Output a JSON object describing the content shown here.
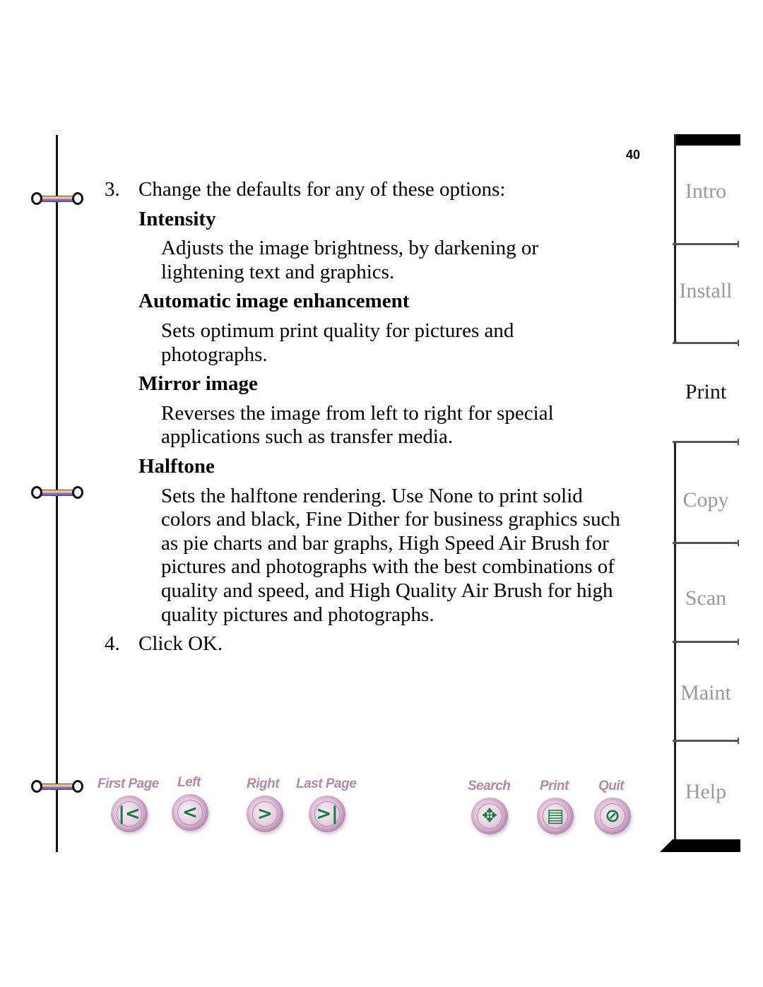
{
  "page_number": "40",
  "steps": {
    "step3": {
      "number": "3.",
      "text": "Change the defaults for any of these options:"
    },
    "step4": {
      "number": "4.",
      "text": "Click OK."
    }
  },
  "options": [
    {
      "title": "Intensity",
      "desc": "Adjusts the image brightness, by darkening or lightening text and graphics."
    },
    {
      "title": "Automatic image enhancement",
      "desc": "Sets optimum print quality for pictures and photographs."
    },
    {
      "title": "Mirror image",
      "desc": "Reverses the image from left to right for special applications such as transfer media."
    },
    {
      "title": "Halftone",
      "desc": "Sets the halftone rendering. Use None to print solid colors and black, Fine Dither for business graphics such as pie charts and bar graphs, High Speed Air Brush for pictures and photographs with the best combinations of quality and speed, and High Quality Air Brush for high quality pictures and photographs."
    }
  ],
  "tabs": [
    {
      "label": "Intro",
      "active": false
    },
    {
      "label": "Install",
      "active": false
    },
    {
      "label": "Print",
      "active": true
    },
    {
      "label": "Copy",
      "active": false
    },
    {
      "label": "Scan",
      "active": false
    },
    {
      "label": "Maint",
      "active": false
    },
    {
      "label": "Help",
      "active": false
    }
  ],
  "nav": {
    "first_page": {
      "label": "First Page",
      "icon": "first-page-icon",
      "glyph": "|<"
    },
    "left": {
      "label": "Left",
      "icon": "left-arrow-icon",
      "glyph": "<"
    },
    "right": {
      "label": "Right",
      "icon": "right-arrow-icon",
      "glyph": ">"
    },
    "last_page": {
      "label": "Last Page",
      "icon": "last-page-icon",
      "glyph": ">|"
    },
    "search": {
      "label": "Search",
      "icon": "binoculars-icon",
      "glyph": "✥"
    },
    "print": {
      "label": "Print",
      "icon": "document-icon",
      "glyph": "▤"
    },
    "quit": {
      "label": "Quit",
      "icon": "no-entry-icon",
      "glyph": "⊘"
    }
  },
  "colors": {
    "nav_label": "#b08aa6",
    "icon_green": "#127a3a",
    "tab_inactive": "#9a9a9a",
    "tab_active": "#111111"
  }
}
